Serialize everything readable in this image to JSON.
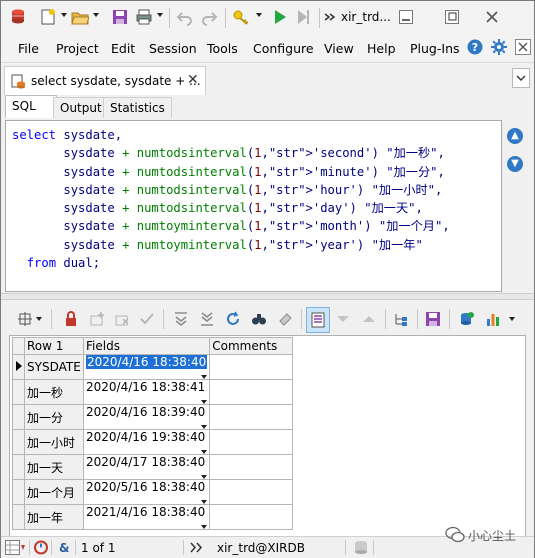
{
  "window": {
    "title": "xir_trd...",
    "colors": {
      "accent": "#1e6fd6",
      "run_green": "#22a843",
      "nav_blue": "#2f79c6"
    }
  },
  "menu": [
    "File",
    "Project",
    "Edit",
    "Session",
    "Tools",
    "Configure",
    "View",
    "Help",
    "Plug-Ins"
  ],
  "doc_tab": {
    "label": "select sysdate, sysdate + ...",
    "close": "✕"
  },
  "sub_tabs": [
    "SQL",
    "Output",
    "Statistics"
  ],
  "editor": {
    "lines": [
      "select sysdate,",
      "       sysdate + numtodsinterval(1,'second') \"加一秒\",",
      "       sysdate + numtodsinterval(1,'minute') \"加一分\",",
      "       sysdate + numtodsinterval(1,'hour') \"加一小时\",",
      "       sysdate + numtodsinterval(1,'day') \"加一天\",",
      "       sysdate + numtoyminterval(1,'month') \"加一个月\",",
      "       sysdate + numtoyminterval(1,'year') \"加一年\"",
      "  from dual;"
    ]
  },
  "grid": {
    "headers": [
      "Row 1",
      "Fields",
      "Comments"
    ],
    "rows": [
      {
        "label": "SYSDATE",
        "value": "2020/4/16 18:38:40",
        "comment": ""
      },
      {
        "label": "加一秒",
        "value": "2020/4/16 18:38:41",
        "comment": ""
      },
      {
        "label": "加一分",
        "value": "2020/4/16 18:39:40",
        "comment": ""
      },
      {
        "label": "加一小时",
        "value": "2020/4/16 19:38:40",
        "comment": ""
      },
      {
        "label": "加一天",
        "value": "2020/4/17 18:38:40",
        "comment": ""
      },
      {
        "label": "加一个月",
        "value": "2020/5/16 18:38:40",
        "comment": ""
      },
      {
        "label": "加一年",
        "value": "2021/4/16 18:38:40",
        "comment": ""
      }
    ]
  },
  "status": {
    "record": "1 of 1",
    "connection": "xir_trd@XIRDB",
    "watermark": "小心尘土"
  }
}
